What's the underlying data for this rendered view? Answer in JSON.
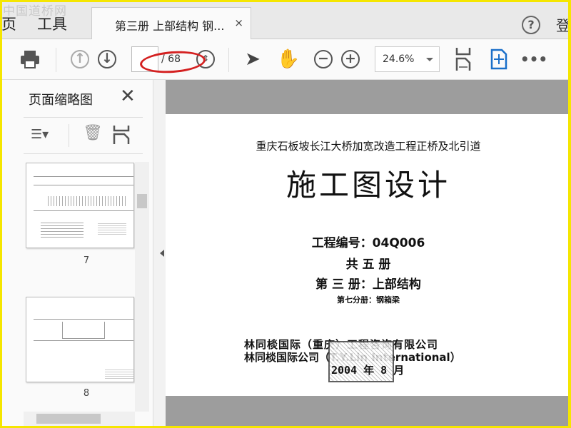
{
  "watermark": "中国道桥网",
  "nav": {
    "home": "页",
    "tools": "工具"
  },
  "doc_tab": {
    "title": "第三册 上部结构 钢...",
    "close": "×"
  },
  "header": {
    "help": "?",
    "login": "登"
  },
  "toolbar": {
    "page_current": "",
    "page_total": "/ 68",
    "zoom": "24.6%"
  },
  "sidebar": {
    "title": "页面缩略图",
    "close": "✕",
    "thumbnails": [
      {
        "label": "7"
      },
      {
        "label": "8"
      }
    ]
  },
  "page": {
    "project": "重庆石板坡长江大桥加宽改造工程正桥及北引道",
    "title": "施工图设计",
    "code": "工程编号：04Q006",
    "volumes": "共 五 册",
    "volume": "第 三 册：上部结构",
    "subvolume": "第七分册：钢箱梁",
    "company1": "林同棪国际（重庆）工程咨询有限公司",
    "company2": "林同棪国际公司（T.Y.Lin International）",
    "date": "2004 年 8 月"
  }
}
